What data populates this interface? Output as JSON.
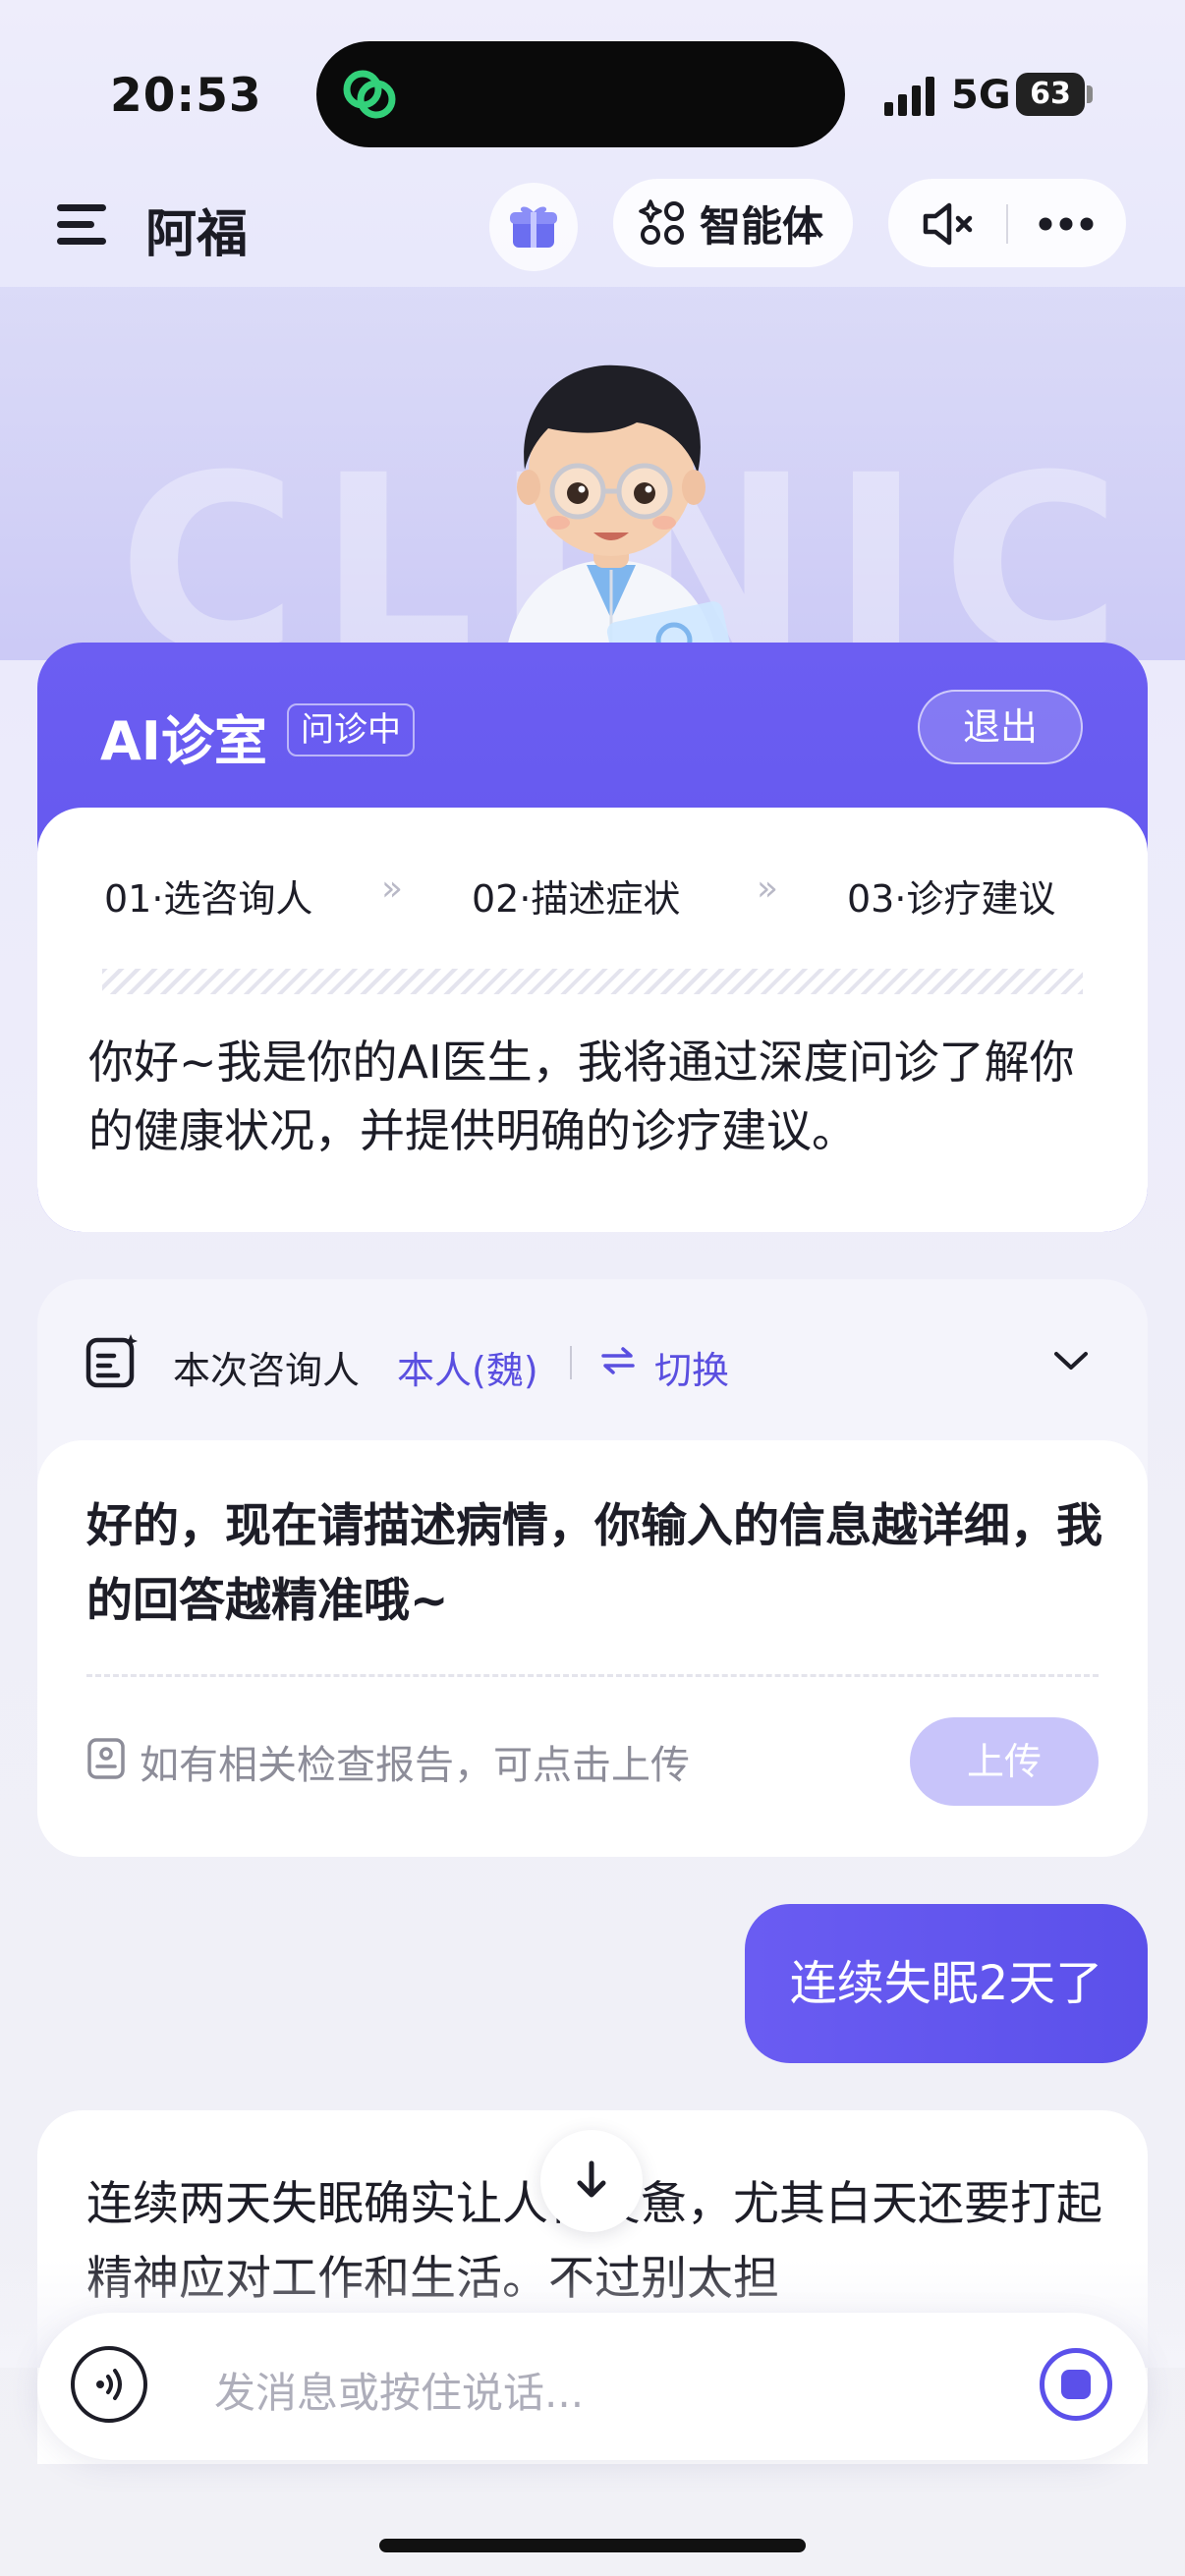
{
  "status_bar": {
    "time": "20:53",
    "network": "5G",
    "battery": "63"
  },
  "header": {
    "title": "阿福",
    "agent_label": "智能体"
  },
  "hero": {
    "background_word": "CLINIC"
  },
  "clinic": {
    "title": "AI诊室",
    "badge": "问诊中",
    "exit_label": "退出",
    "steps": [
      {
        "label": "01·选咨询人"
      },
      {
        "label": "02·描述症状"
      },
      {
        "label": "03·诊疗建议"
      }
    ],
    "step_separator": "»",
    "intro": "你好~我是你的AI医生，我将通过深度问诊了解你的健康状况，并提供明确的诊疗建议。"
  },
  "consult": {
    "label": "本次咨询人",
    "person": "本人(魏)",
    "switch_label": "切换",
    "prompt": "好的，现在请描述病情，你输入的信息越详细，我的回答越精准哦~",
    "report_hint": "如有相关检查报告，可点击上传",
    "upload_label": "上传"
  },
  "messages": {
    "user": "连续失眠2天了",
    "ai_reply": "连续两天失眠确实让人很疲惫，尤其白天还要打起精神应对工作和生活。不过别太担"
  },
  "input": {
    "placeholder": "发消息或按住说话..."
  },
  "colors": {
    "accent": "#5b50ea",
    "accent_light": "#c8c4fa",
    "background": "#eeedfb"
  }
}
